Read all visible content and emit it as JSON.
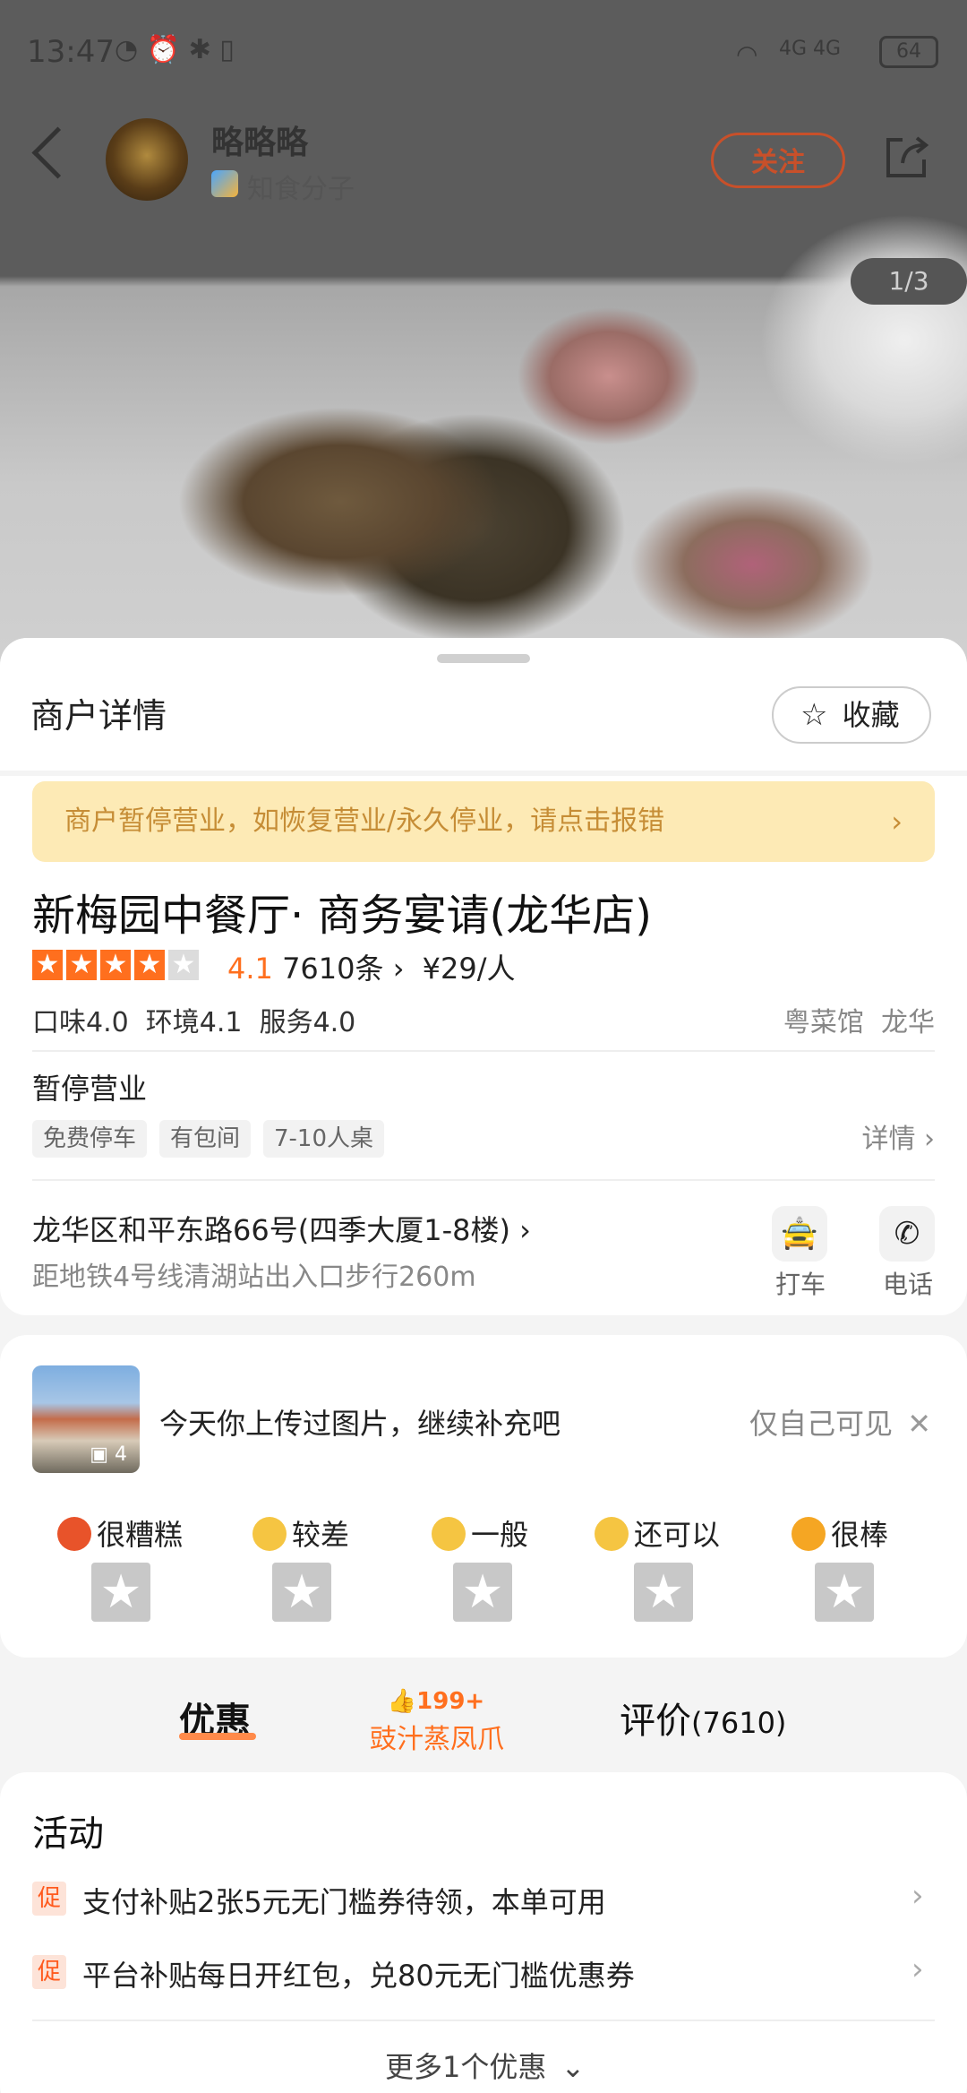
{
  "status_bar": {
    "time": "13:47",
    "network": "4G 4G",
    "battery": "64"
  },
  "header": {
    "username": "略略略",
    "level": "知食分子",
    "follow_label": "关注",
    "page_indicator": "1/3"
  },
  "sheet": {
    "title": "商户详情",
    "favorite_label": "收藏",
    "banner_text": "商户暂停营业，如恢复营业/永久停业，请点击报错",
    "shop_name": "新梅园中餐厅· 商务宴请(龙华店)",
    "rating": 4.1,
    "rating_text": "4.1",
    "reviews_text": "7610条",
    "price_text": "¥29/人",
    "sub_scores": "口味4.0  环境4.1  服务4.0",
    "category": "粤菜馆  龙华",
    "status_title": "暂停营业",
    "tags": [
      "免费停车",
      "有包间",
      "7-10人桌"
    ],
    "detail_label": "详情",
    "address": "龙华区和平东路66号(四季大厦1-8楼)",
    "subway": "距地铁4号线清湖站出入口步行260m",
    "taxi_label": "打车",
    "phone_label": "电话"
  },
  "upload": {
    "photo_count": "4",
    "prompt": "今天你上传过图片，继续补充吧",
    "visibility": "仅自己可见",
    "ratings": [
      {
        "label": "很糟糕",
        "color": "#e8532a"
      },
      {
        "label": "较差",
        "color": "#f5c542"
      },
      {
        "label": "一般",
        "color": "#f5c542"
      },
      {
        "label": "还可以",
        "color": "#f5c542"
      },
      {
        "label": "很棒",
        "color": "#f5a623"
      }
    ]
  },
  "tabs": {
    "deals": "优惠",
    "promo_count": "199+",
    "promo_dish": "豉汁蒸凤爪",
    "reviews_label": "评价",
    "reviews_count": "(7610)"
  },
  "activities": {
    "title": "活动",
    "badge": "促",
    "items": [
      "支付补贴2张5元无门槛券待领，本单可用",
      "平台补贴每日开红包，兑80元无门槛优惠券"
    ],
    "more": "更多1个优惠"
  },
  "colors": {
    "accent": "#ff6f1e",
    "banner_bg": "#fdeab5",
    "banner_text": "#c68d36"
  }
}
